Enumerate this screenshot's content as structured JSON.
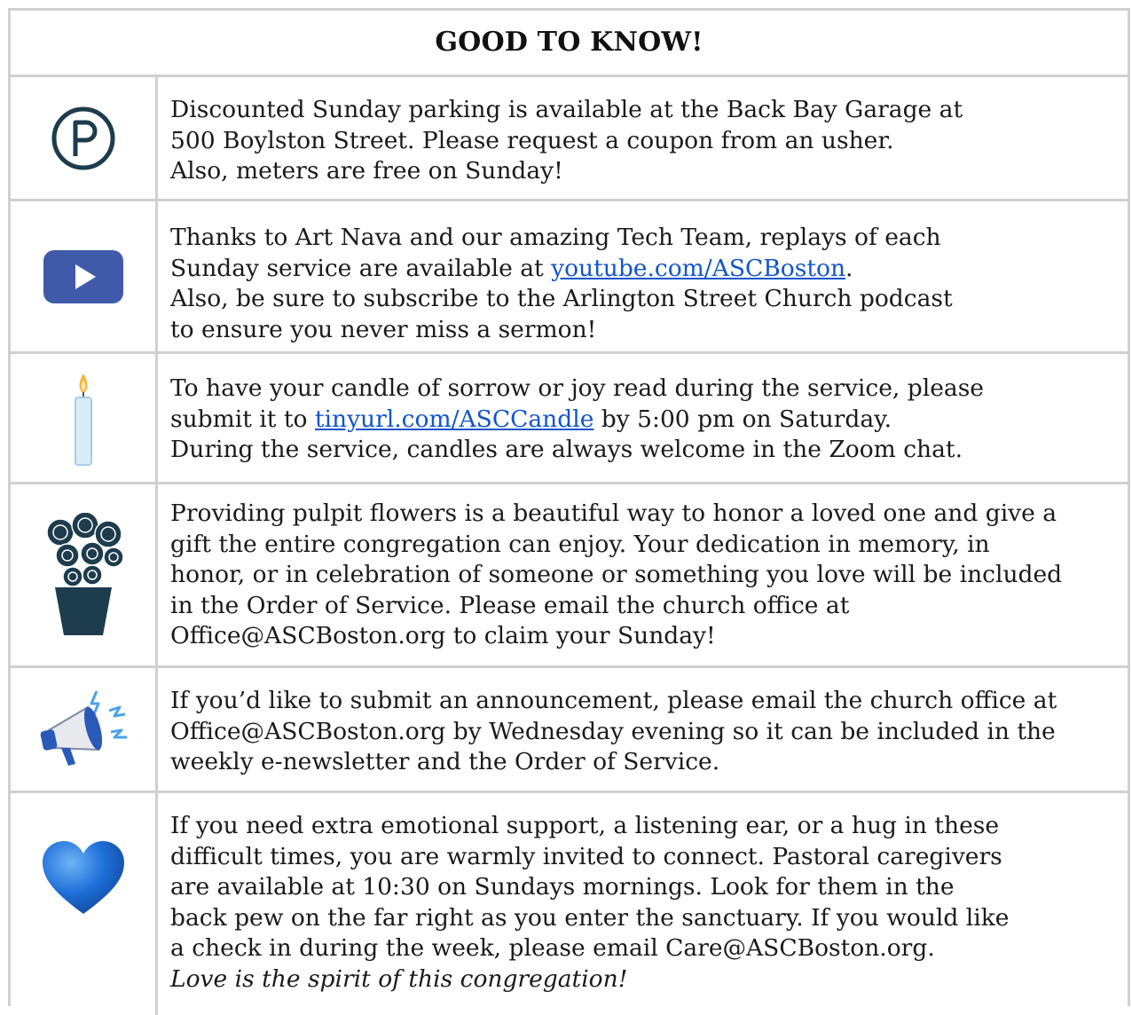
{
  "heading": "GOOD TO KNOW!",
  "items": [
    {
      "icon": "parking-icon",
      "text": "Discounted Sunday parking is available at the Back Bay Garage at\n500 Boylston Street. Please request a coupon from an usher.\nAlso, meters are free on Sunday!"
    },
    {
      "icon": "video-play-icon",
      "before": "Thanks to Art Nava and our amazing Tech Team, replays of each\nSunday service are available at ",
      "link": "youtube.com/ASCBoston",
      "after": ".\nAlso, be sure to subscribe to the Arlington Street Church podcast\nto ensure you never miss a sermon!"
    },
    {
      "icon": "candle-icon",
      "before": "To have your candle of sorrow or joy read during the service, please\nsubmit it to ",
      "link": "tinyurl.com/ASCCandle",
      "after": " by 5:00 pm on Saturday.\nDuring the service, candles are always welcome in the Zoom chat."
    },
    {
      "icon": "flowers-icon",
      "text": "Providing pulpit flowers is a beautiful way to honor a loved one and give a\ngift the entire congregation can enjoy. Your dedication in memory, in\nhonor, or in celebration of someone or something you love will be included\nin the Order of Service. Please email the church office at\nOffice@ASCBoston.org to claim your Sunday!"
    },
    {
      "icon": "megaphone-icon",
      "text": "If you’d like to submit an announcement, please email the church office at\nOffice@ASCBoston.org by Wednesday evening so it can be included in the\nweekly e-newsletter and the Order of Service."
    },
    {
      "icon": "blue-heart-icon",
      "text": "If you need extra emotional support, a listening ear, or a hug in these\ndifficult times, you are warmly invited to connect. Pastoral caregivers\nare available at 10:30 on Sundays mornings. Look for them in the\nback pew on the far right as you enter the sanctuary. If you would like\na check in during the week, please email Care@ASCBoston.org.",
      "closing": "Love is the spirit of this congregation!"
    }
  ],
  "colors": {
    "border": "#d0d0d0",
    "link": "#1155cc",
    "parking": "#1d3c4d",
    "video": "#3f5aa8",
    "heart": "#1e6fd9"
  }
}
